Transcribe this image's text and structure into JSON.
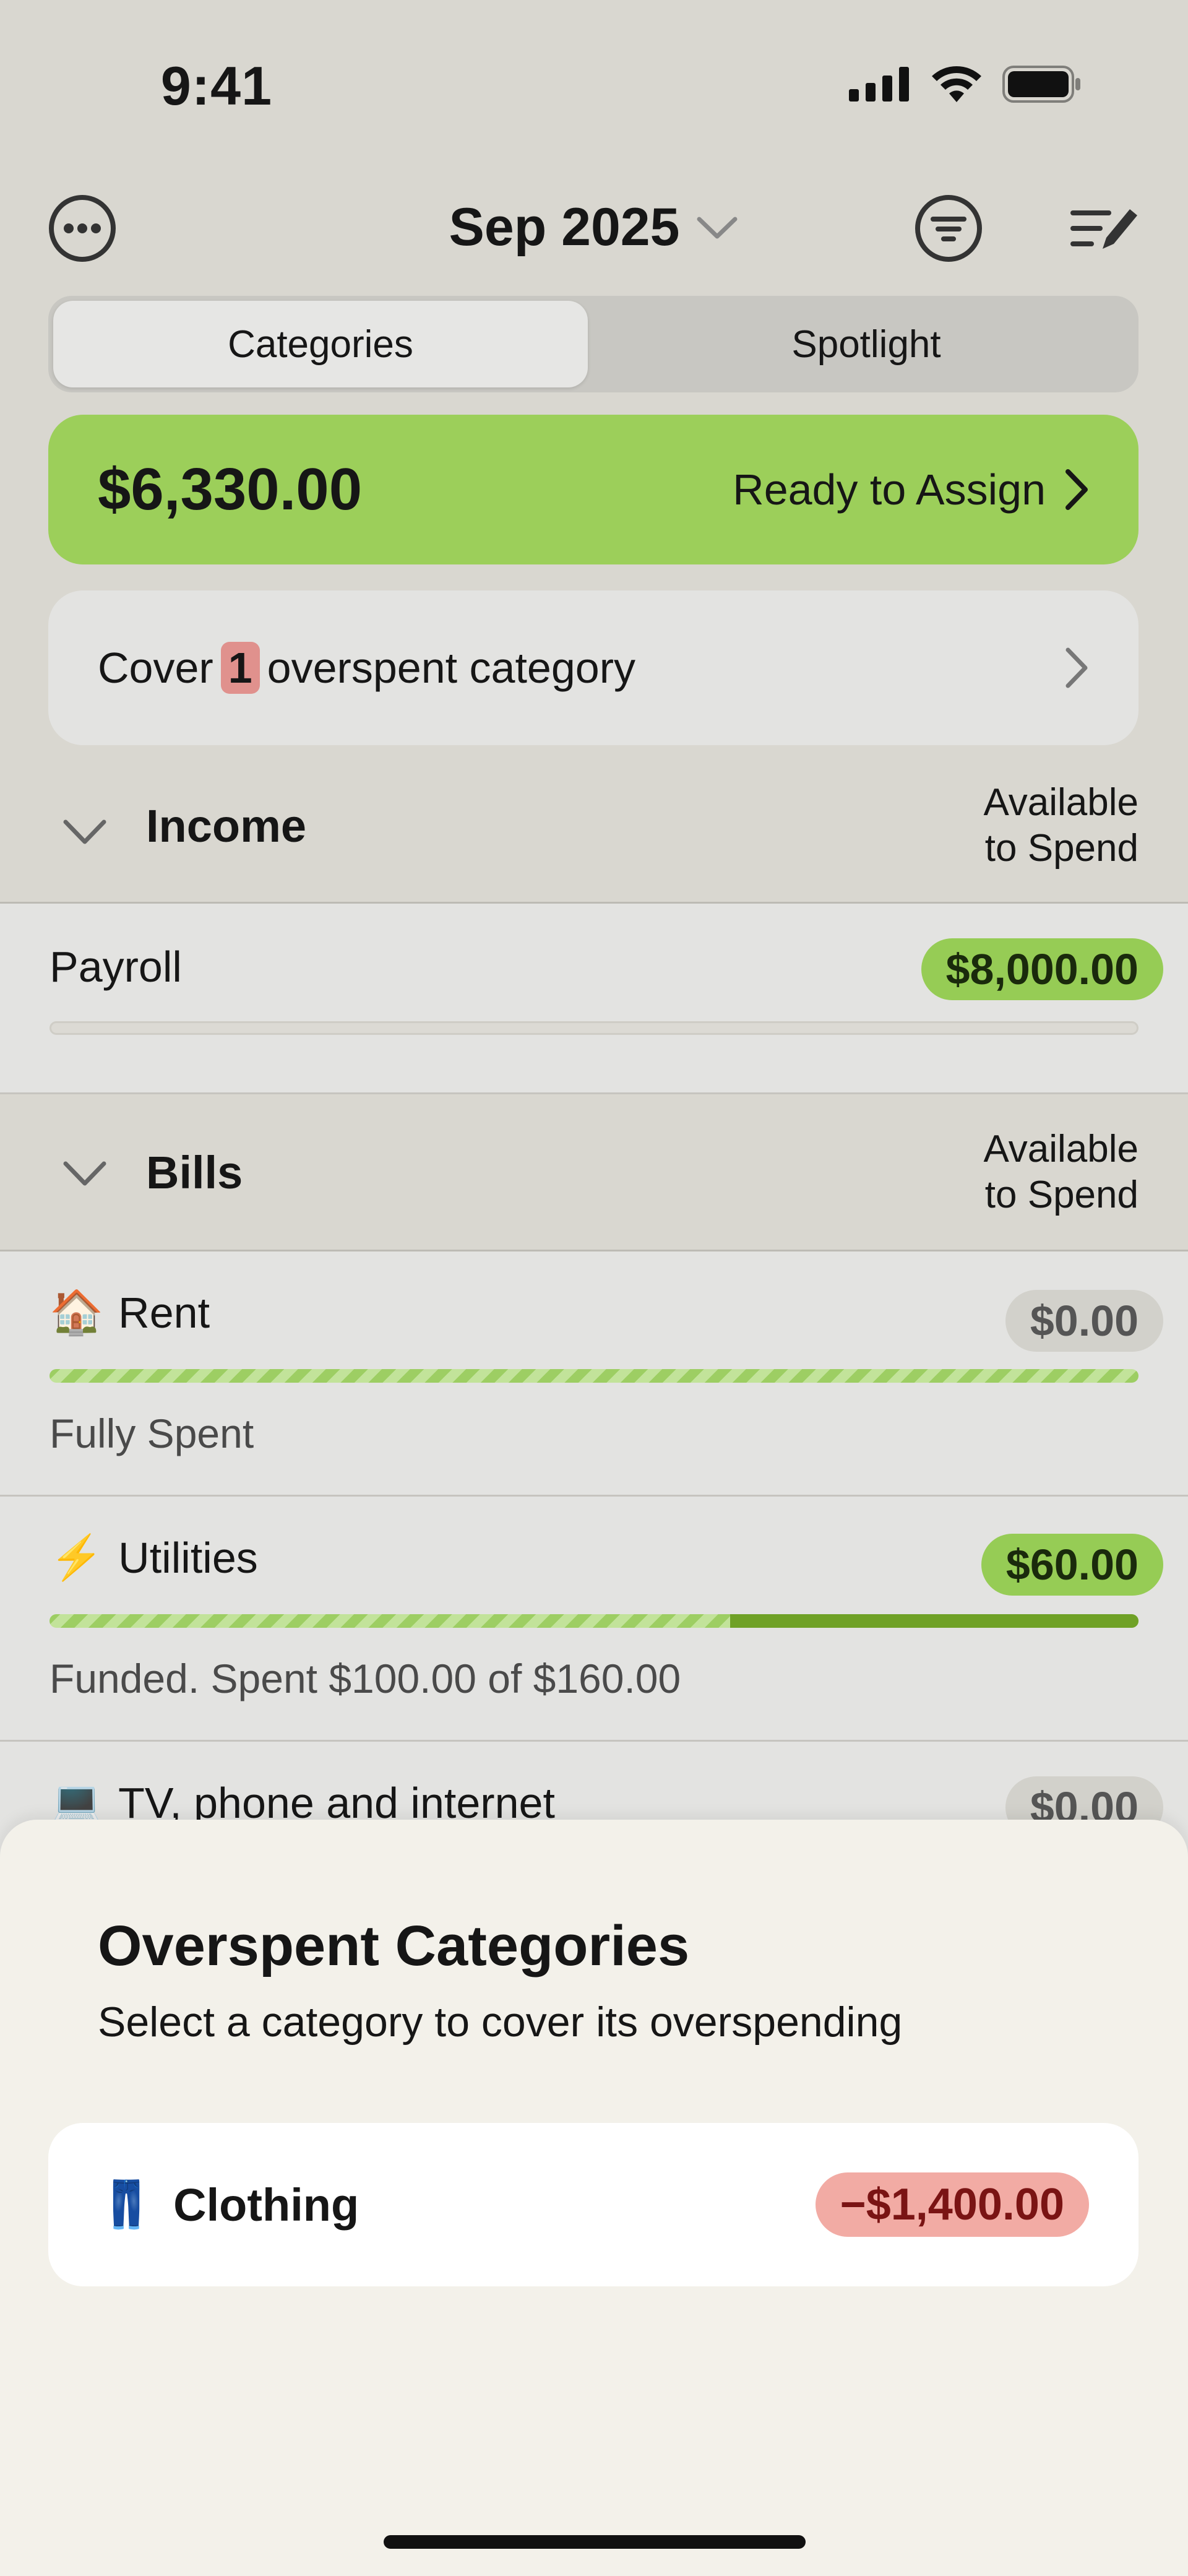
{
  "status_bar": {
    "time": "9:41",
    "icons": [
      "signal-icon",
      "wifi-icon",
      "battery-icon"
    ]
  },
  "header": {
    "month": "Sep 2025",
    "icons": [
      "more-icon",
      "filter-icon",
      "edit-list-icon"
    ]
  },
  "tabs": {
    "items": [
      {
        "label": "Categories",
        "active": true
      },
      {
        "label": "Spotlight",
        "active": false
      }
    ]
  },
  "ready_to_assign": {
    "amount": "$6,330.00",
    "label": "Ready to Assign",
    "color": "#9ccf5a"
  },
  "cover": {
    "prefix": "Cover",
    "count": "1",
    "suffix": "overspent category"
  },
  "groups": {
    "income": {
      "title": "Income",
      "available_line1": "Available",
      "available_line2": "to Spend",
      "rows": [
        {
          "name": "Payroll",
          "amount": "$8,000.00"
        }
      ]
    },
    "bills": {
      "title": "Bills",
      "available_line1": "Available",
      "available_line2": "to Spend",
      "rows": [
        {
          "emoji": "🏠",
          "name": "Rent",
          "amount": "$0.00",
          "status": "Fully Spent",
          "spent_fraction": 1.0
        },
        {
          "emoji": "⚡",
          "name": "Utilities",
          "amount": "$60.00",
          "status": "Funded. Spent $100.00 of $160.00",
          "spent_fraction": 0.625
        },
        {
          "emoji": "💻",
          "name": "TV, phone and internet",
          "amount": "$0.00"
        }
      ]
    }
  },
  "sheet": {
    "title": "Overspent Categories",
    "subtitle": "Select a category to cover its overspending",
    "items": [
      {
        "emoji": "👖",
        "name": "Clothing",
        "amount": "−$1,400.00"
      }
    ]
  }
}
